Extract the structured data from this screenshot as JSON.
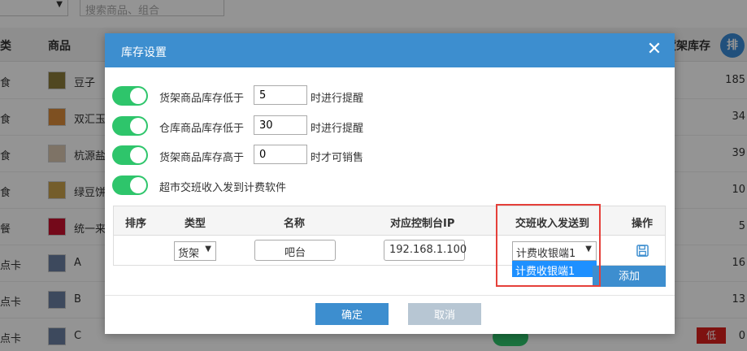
{
  "background": {
    "category_select_arrow": "▼",
    "search_placeholder": "搜索商品、组合",
    "headers": {
      "category": "类",
      "product": "商品",
      "shelf_stock": "货架库存",
      "sort_button": "排"
    },
    "rows": [
      {
        "category": "食",
        "name": "豆子",
        "qty": "185",
        "thumb_color": "#8a7b3a"
      },
      {
        "category": "食",
        "name": "双汇玉",
        "qty": "34",
        "thumb_color": "#d98a3a"
      },
      {
        "category": "食",
        "name": "杭源盐",
        "qty": "39",
        "thumb_color": "#d9c7b0"
      },
      {
        "category": "食",
        "name": "绿豆饼",
        "qty": "10",
        "thumb_color": "#c9a04a"
      },
      {
        "category": "餐",
        "name": "统一来",
        "qty": "5",
        "thumb_color": "#c8102e"
      },
      {
        "category": "点卡",
        "name": "A",
        "qty": "16",
        "thumb_color": "#6a7fa0"
      },
      {
        "category": "点卡",
        "name": "B",
        "qty": "13",
        "thumb_color": "#6a7fa0"
      },
      {
        "category": "点卡",
        "name": "C",
        "qty": "0",
        "thumb_color": "#6a7fa0"
      }
    ],
    "low_badge": "低"
  },
  "modal": {
    "title": "库存设置",
    "close_glyph": "✕",
    "settings": [
      {
        "label": "货架商品库存低于",
        "value": "5",
        "suffix": "时进行提醒"
      },
      {
        "label": "仓库商品库存低于",
        "value": "30",
        "suffix": "时进行提醒"
      },
      {
        "label": "货架商品库存高于",
        "value": "0",
        "suffix": "时才可销售"
      },
      {
        "label": "超市交班收入发到计费软件"
      }
    ],
    "table": {
      "headers": {
        "order": "排序",
        "type": "类型",
        "name": "名称",
        "ip": "对应控制台IP",
        "send_to": "交班收入发送到",
        "action": "操作"
      },
      "row": {
        "type": "货架",
        "name": "吧台",
        "ip": "192.168.1.100",
        "send_to": "计费收银端1"
      },
      "arrow": "▼"
    },
    "dropdown_option": "计费收银端1",
    "add_button": "添加",
    "ok_button": "确定",
    "cancel_button": "取消"
  },
  "colors": {
    "accent": "#3d8ecf",
    "toggle_on": "#2ec56b",
    "highlight_box": "#e5403a",
    "dropdown_selected": "#1e90ff"
  }
}
